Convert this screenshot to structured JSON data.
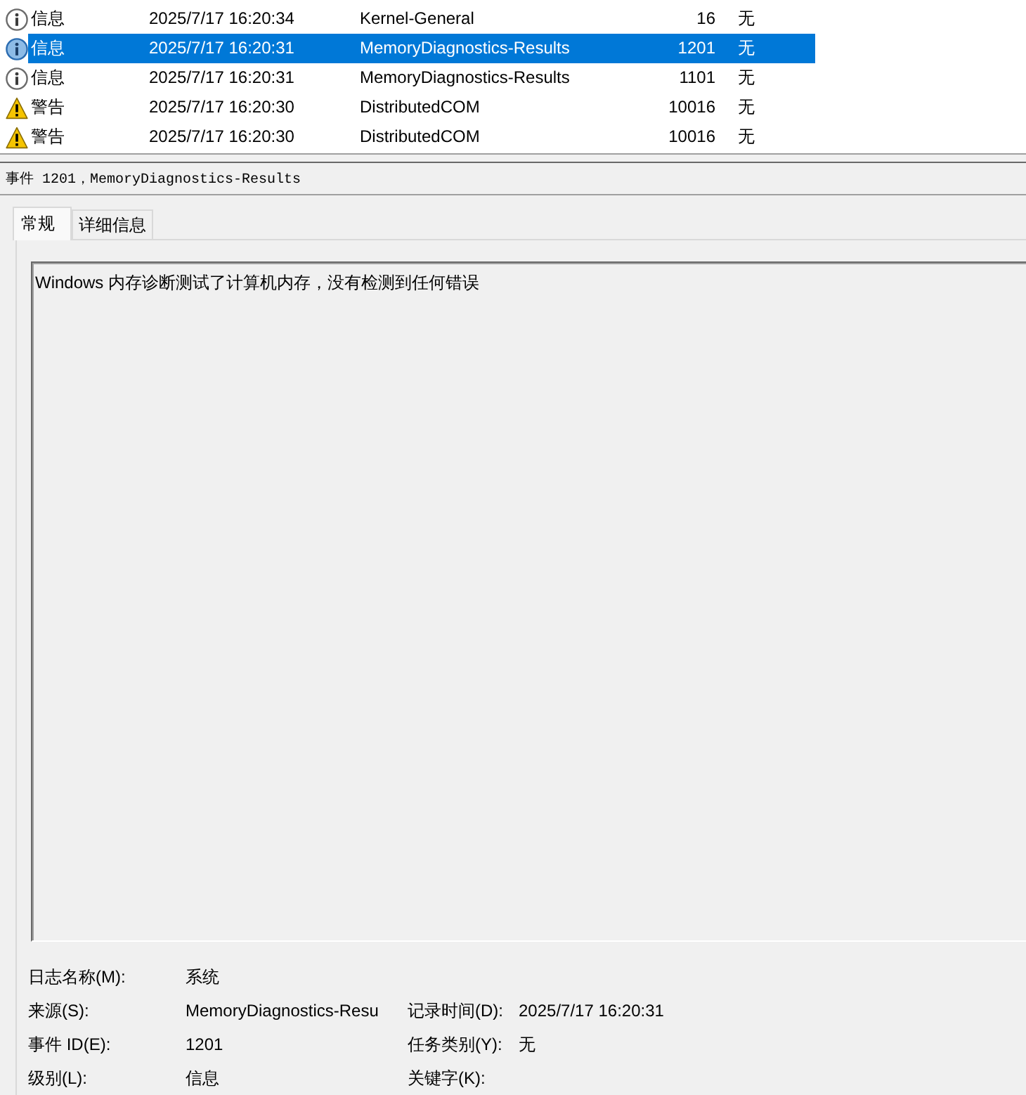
{
  "event_list": {
    "rows": [
      {
        "kind": "info",
        "severity": "信息",
        "date_time": "2025/7/17 16:20:34",
        "source": "Kernel-General",
        "event_id": "16",
        "task_category": "无",
        "selected": false
      },
      {
        "kind": "info",
        "severity": "信息",
        "date_time": "2025/7/17 16:20:31",
        "source": "MemoryDiagnostics-Results",
        "event_id": "1201",
        "task_category": "无",
        "selected": true
      },
      {
        "kind": "info",
        "severity": "信息",
        "date_time": "2025/7/17 16:20:31",
        "source": "MemoryDiagnostics-Results",
        "event_id": "1101",
        "task_category": "无",
        "selected": false
      },
      {
        "kind": "warning",
        "severity": "警告",
        "date_time": "2025/7/17 16:20:30",
        "source": "DistributedCOM",
        "event_id": "10016",
        "task_category": "无",
        "selected": false
      },
      {
        "kind": "warning",
        "severity": "警告",
        "date_time": "2025/7/17 16:20:30",
        "source": "DistributedCOM",
        "event_id": "10016",
        "task_category": "无",
        "selected": false
      }
    ]
  },
  "event_header": {
    "title": "事件 1201，MemoryDiagnostics-Results"
  },
  "tabs": [
    {
      "label": "常规",
      "selected": true
    },
    {
      "label": "详细信息",
      "selected": false
    }
  ],
  "general": {
    "description": "Windows 内存诊断测试了计算机内存，没有检测到任何错误",
    "fields": {
      "rows": [
        {
          "items": [
            {
              "label": "日志名称(M):",
              "value": "系统"
            }
          ]
        },
        {
          "items": [
            {
              "label": "来源(S):",
              "value": "MemoryDiagnostics-Resu"
            },
            {
              "label": "记录时间(D):",
              "value": "2025/7/17 16:20:31"
            }
          ]
        },
        {
          "items": [
            {
              "label": "事件 ID(E):",
              "value": "1201"
            },
            {
              "label": "任务类别(Y):",
              "value": "无"
            }
          ]
        },
        {
          "items": [
            {
              "label": "级别(L):",
              "value": "信息"
            },
            {
              "label": "关键字(K):"
            }
          ]
        }
      ]
    }
  }
}
